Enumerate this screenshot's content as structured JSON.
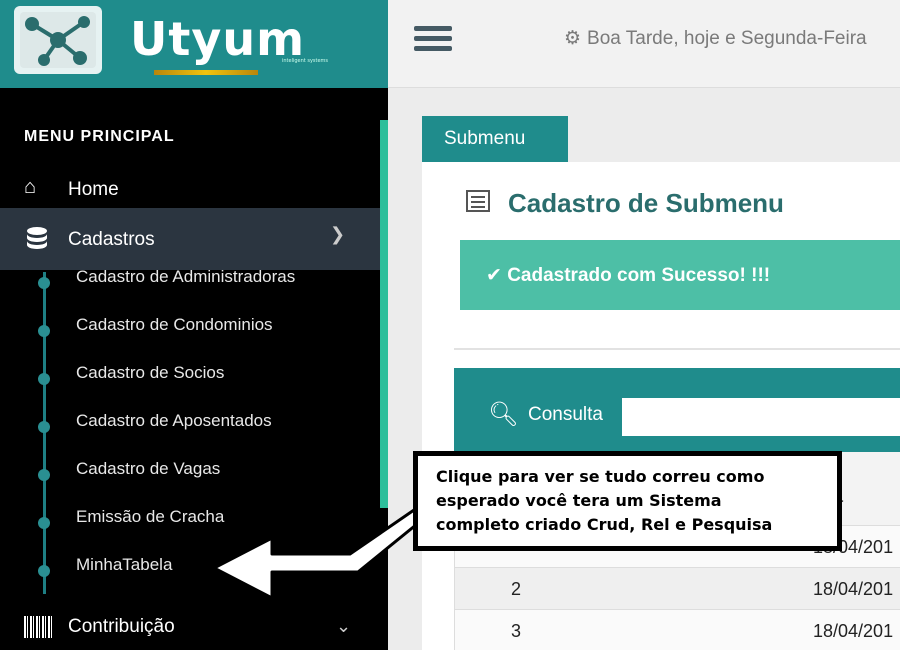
{
  "brand": {
    "name": "Utyum",
    "tagline": "inteligent systems"
  },
  "topbar": {
    "greeting": "Boa Tarde, hoje e Segunda-Feira"
  },
  "sidebar": {
    "title": "MENU PRINCIPAL",
    "home": {
      "label": "Home"
    },
    "cadastros": {
      "label": "Cadastros",
      "items": [
        {
          "label": "Cadastro de Administradoras"
        },
        {
          "label": "Cadastro de Condominios"
        },
        {
          "label": "Cadastro de Socios"
        },
        {
          "label": "Cadastro de Aposentados"
        },
        {
          "label": "Cadastro de Vagas"
        },
        {
          "label": "Emissão de Cracha"
        },
        {
          "label": "MinhaTabela"
        }
      ]
    },
    "contribuicao": {
      "label": "Contribuição"
    }
  },
  "main": {
    "tab": "Submenu",
    "title": "Cadastro de Submenu",
    "alert": "Cadastrado com Sucesso! !!!",
    "search": {
      "label": "Consulta",
      "value": ""
    },
    "grid": {
      "header_partial": "ta",
      "rows": [
        {
          "id": "",
          "date": "18/04/201"
        },
        {
          "id": "2",
          "date": "18/04/201"
        },
        {
          "id": "3",
          "date": "18/04/201"
        }
      ]
    }
  },
  "annotation": {
    "lines": [
      "Clique para ver se tudo correu como",
      "esperado você tera um Sistema",
      "completo criado Crud, Rel e Pesquisa"
    ]
  }
}
